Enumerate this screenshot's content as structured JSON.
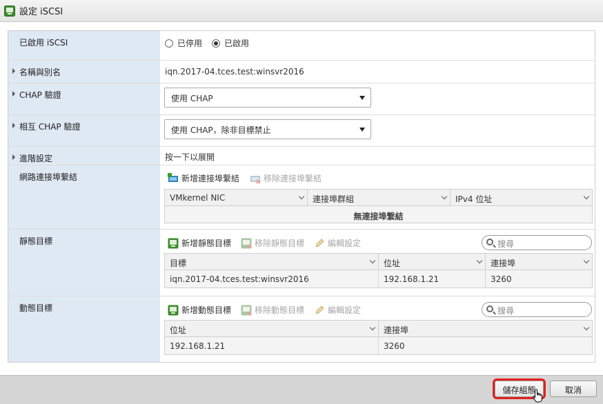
{
  "window": {
    "title": "設定 iSCSI"
  },
  "rows": {
    "enabled": {
      "label": "已啟用 iSCSI",
      "opt_disabled": "已停用",
      "opt_enabled": "已啟用",
      "selected": "enabled"
    },
    "name": {
      "label": "名稱與別名",
      "value": "iqn.2017-04.tces.test:winsvr2016"
    },
    "chap": {
      "label": "CHAP 驗證",
      "value": "使用 CHAP"
    },
    "mutual": {
      "label": "相互 CHAP 驗證",
      "value": "使用 CHAP，除非目標禁止"
    },
    "advanced": {
      "label": "進階設定",
      "value": "按一下以展開"
    },
    "binding": {
      "label": "網路連接埠繫結",
      "add": "新增連接埠繫結",
      "remove": "移除連接埠繫結",
      "columns": [
        "VMkernel NIC",
        "連接埠群組",
        "IPv4 位址"
      ],
      "empty": "無連接埠繫結"
    },
    "static": {
      "label": "靜態目標",
      "add": "新增靜態目標",
      "remove": "移除靜態目標",
      "edit": "編輯設定",
      "search_placeholder": "搜尋",
      "columns": [
        "目標",
        "位址",
        "連接埠"
      ],
      "rows": [
        [
          "iqn.2017-04.tces.test:winsvr2016",
          "192.168.1.21",
          "3260"
        ]
      ]
    },
    "dynamic": {
      "label": "動態目標",
      "add": "新增動態目標",
      "remove": "移除動態目標",
      "edit": "編輯設定",
      "search_placeholder": "搜尋",
      "columns": [
        "位址",
        "連接埠"
      ],
      "rows": [
        [
          "192.168.1.21",
          "3260"
        ]
      ]
    }
  },
  "footer": {
    "save": "儲存組態",
    "cancel": "取消"
  }
}
